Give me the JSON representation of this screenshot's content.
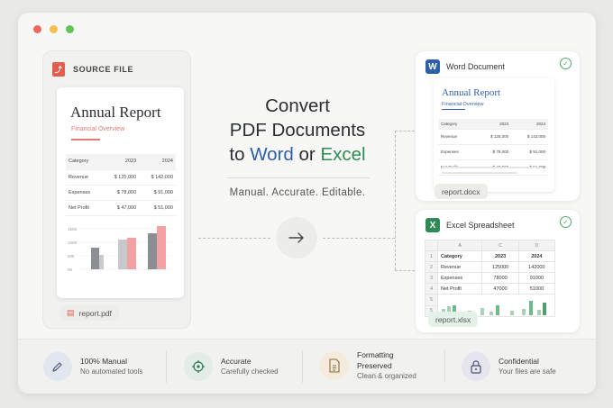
{
  "colors": {
    "red_dot": "#ec6a5e",
    "yellow_dot": "#f4bf4f",
    "green_dot": "#61c554",
    "pdf": "#e45b50",
    "word": "#2f5fa8",
    "excel": "#2f8a55"
  },
  "source": {
    "label": "SOURCE FILE",
    "doc_title": "Annual Report",
    "doc_subtitle": "Financial Overview",
    "table": {
      "headers": [
        "Category",
        "2023",
        "2024"
      ],
      "rows": [
        [
          "Revenue",
          "$ 125,000",
          "$ 142,000"
        ],
        [
          "Expenses",
          "$ 78,000",
          "$ 91,000"
        ],
        [
          "Net Profit",
          "$ 47,000",
          "$ 51,000"
        ]
      ]
    },
    "chart_ticks": [
      "150K",
      "100K",
      "50K",
      "0K"
    ],
    "file_name": "report.pdf"
  },
  "hero": {
    "line1": "Convert",
    "line2": "PDF Documents",
    "line3_to": "to",
    "line3_word": "Word",
    "line3_or": "or",
    "line3_excel": "Excel",
    "tagline": "Manual. Accurate. Editable."
  },
  "word": {
    "label": "Word Document",
    "doc_title": "Annual Report",
    "doc_subtitle": "Financial Overview",
    "table": {
      "headers": [
        "Category",
        "2023",
        "2024"
      ],
      "rows": [
        [
          "Revenue",
          "$ 125,000",
          "$ 142,000"
        ],
        [
          "Expenses",
          "$ 78,000",
          "$ 91,000"
        ],
        [
          "Net Profit",
          "$ 47,000",
          "$ 51,000"
        ]
      ]
    },
    "file_name": "report.docx"
  },
  "excel": {
    "label": "Excel Spreadsheet",
    "columns": [
      "A",
      "C",
      "D"
    ],
    "rows": [
      [
        "1",
        "Category",
        "2023",
        "2024"
      ],
      [
        "2",
        "Revenue",
        "125000",
        "142000"
      ],
      [
        "3",
        "Expenses",
        "78000",
        "91000"
      ],
      [
        "4",
        "Net Profit",
        "47000",
        "51000"
      ],
      [
        "5",
        "",
        "",
        ""
      ],
      [
        "5",
        "",
        "",
        ""
      ]
    ],
    "file_name": "report.xlsx"
  },
  "features": [
    {
      "title": "100% Manual",
      "subtitle": "No automated tools",
      "icon": "pencil-icon"
    },
    {
      "title": "Accurate",
      "subtitle": "Carefully checked",
      "icon": "target-icon"
    },
    {
      "title": "Formatting",
      "title2": "Preserved",
      "subtitle": "Clean & organized",
      "icon": "document-icon"
    },
    {
      "title": "Confidential",
      "subtitle": "Your files are safe",
      "icon": "lock-icon"
    }
  ]
}
